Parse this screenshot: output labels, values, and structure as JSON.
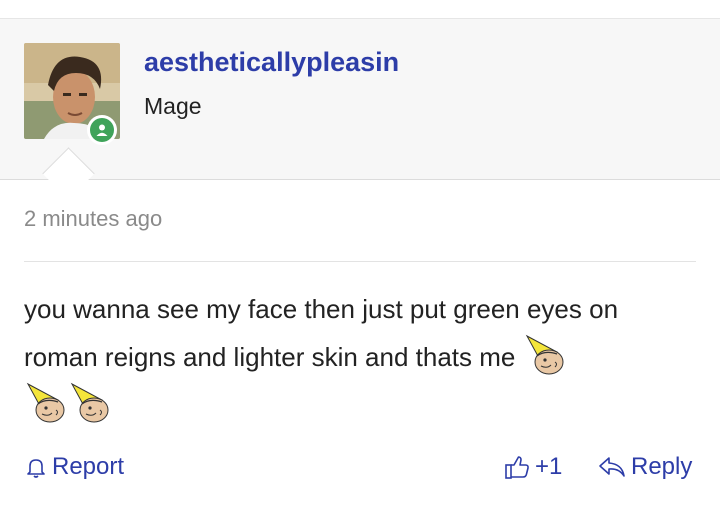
{
  "comment": {
    "username": "aestheticallypleasin",
    "rank": "Mage",
    "timestamp": "2 minutes ago",
    "body": "you wanna see my face then just put green eyes on roman reigns and lighter skin and thats me",
    "emote_icon": "gnome-emote-icon"
  },
  "actions": {
    "report_label": "Report",
    "like_label": "+1",
    "reply_label": "Reply"
  },
  "colors": {
    "accent": "#2d3da8",
    "online": "#3fa35a",
    "header_bg": "#f7f7f7",
    "muted_text": "#8a8a8a"
  }
}
